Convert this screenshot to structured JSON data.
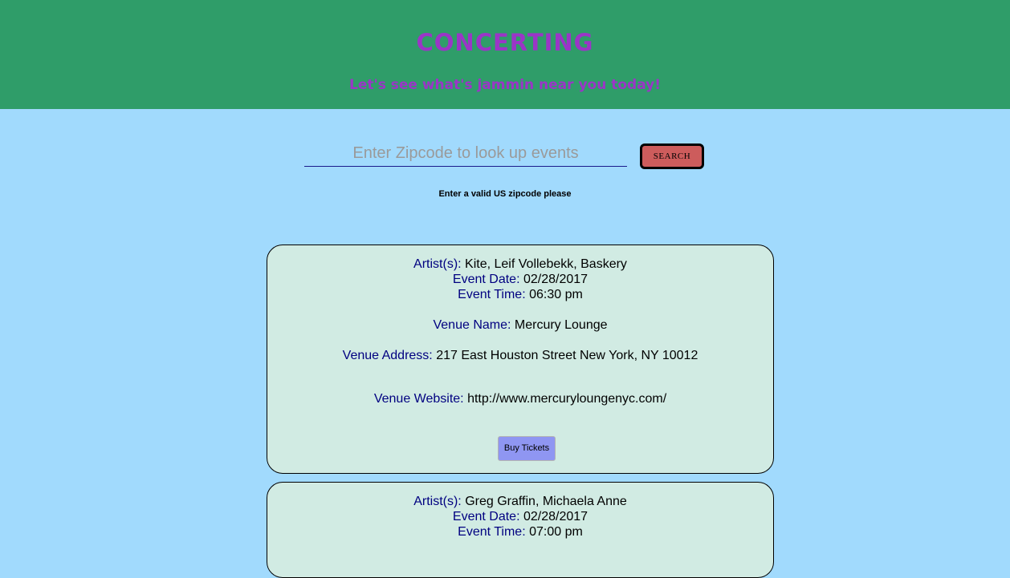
{
  "header": {
    "title": "CONCERTING",
    "subtitle": "Let's see what's jammin near you today!"
  },
  "search": {
    "placeholder": "Enter Zipcode to look up events",
    "value": "",
    "button_label": "SEARCH",
    "hint": "Enter a valid US zipcode please"
  },
  "labels": {
    "artists": "Artist(s):",
    "event_date": "Event Date:",
    "event_time": "Event Time:",
    "venue_name": "Venue Name:",
    "venue_address": "Venue Address:",
    "venue_website": "Venue Website:",
    "buy_tickets": "Buy Tickets"
  },
  "events": [
    {
      "artists": "Kite, Leif Vollebekk, Baskery",
      "date": "02/28/2017",
      "time": "06:30 pm",
      "venue_name": "Mercury Lounge",
      "venue_address": "217 East Houston Street New York, NY 10012",
      "venue_website": "http://www.mercuryloungenyc.com/"
    },
    {
      "artists": "Greg Graffin, Michaela Anne",
      "date": "02/28/2017",
      "time": "07:00 pm"
    }
  ],
  "colors": {
    "header_bg": "#2f9d69",
    "page_bg": "#a1dafd",
    "title_color": "#9b35c7",
    "card_bg": "#d1ebe3",
    "label_color": "#000080",
    "search_button_bg": "#cd5c5c",
    "buy_button_bg": "#8f96f2"
  }
}
